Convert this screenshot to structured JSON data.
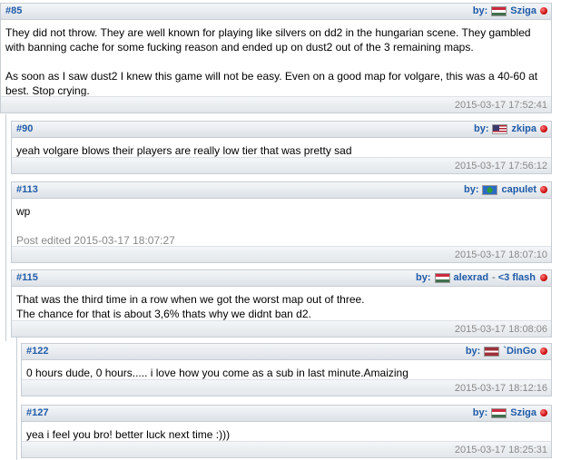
{
  "posts": [
    {
      "number": "#85",
      "by_label": "by:",
      "username": "Sziga",
      "flag": "flag-hu",
      "body": [
        "They did not throw. They are well known for playing like silvers on dd2 in the hungarian scene. They gambled with banning cache for some fucking reason and ended up on dust2 out of the 3 remaining maps.",
        "As soon as I saw dust2 I knew this game will not be easy. Even on a good map for volgare, this was a 40-60 at best. Stop crying."
      ],
      "timestamp": "2015-03-17 17:52:41"
    },
    {
      "number": "#90",
      "by_label": "by:",
      "username": "zkipa",
      "flag": "flag-us",
      "body": [
        "yeah volgare blows their players are really low tier that was pretty sad"
      ],
      "timestamp": "2015-03-17 17:56:12"
    },
    {
      "number": "#113",
      "by_label": "by:",
      "username": "capulet",
      "flag": "flag-world",
      "body": [
        "wp"
      ],
      "edited": "Post edited 2015-03-17 18:07:27",
      "timestamp": "2015-03-17 18:07:10"
    },
    {
      "number": "#115",
      "by_label": "by:",
      "username": "alexrad",
      "flag": "flag-hu",
      "separator": "-",
      "user_tag": "<3 flash",
      "body": [
        "That was the third time in a row when we got the worst map out of three.\nThe chance for that is about 3,6% thats why we didnt ban d2."
      ],
      "timestamp": "2015-03-17 18:08:06"
    },
    {
      "number": "#122",
      "by_label": "by:",
      "username": "`DinGo",
      "flag": "flag-lv",
      "body": [
        "0 hours dude, 0 hours..... i love how you come as a sub in last minute.Amaizing"
      ],
      "timestamp": "2015-03-17 18:12:16"
    },
    {
      "number": "#127",
      "by_label": "by:",
      "username": "Sziga",
      "flag": "flag-hu",
      "body": [
        "yea i feel you bro! better luck next time :)))"
      ],
      "timestamp": "2015-03-17 18:25:31"
    }
  ],
  "colors": {
    "link_blue": "#1f5ba8",
    "timestamp_grey": "#888888",
    "status_red": "#c40000"
  }
}
